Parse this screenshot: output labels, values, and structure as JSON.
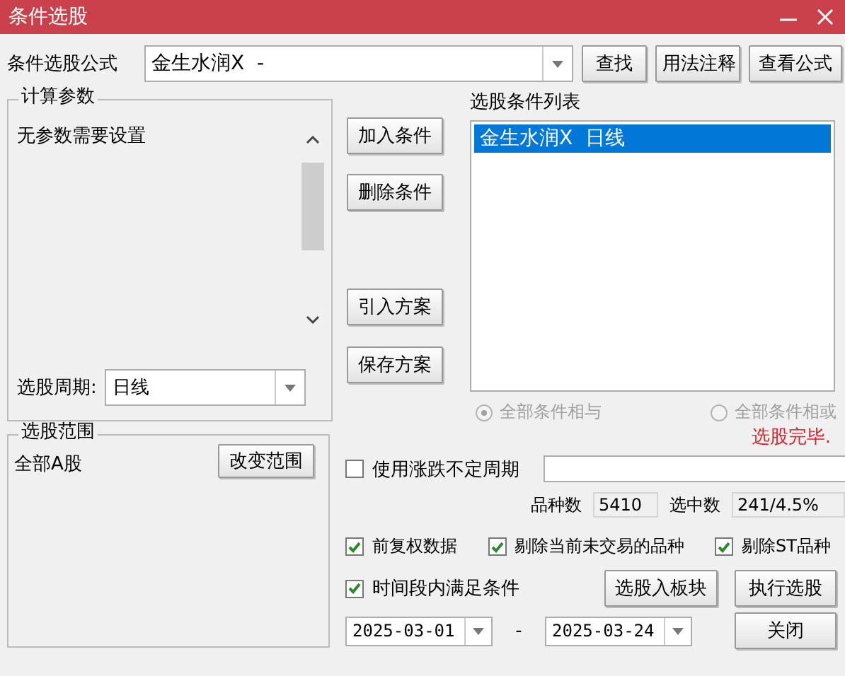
{
  "window": {
    "title": "条件选股"
  },
  "formula": {
    "label": "条件选股公式",
    "value": "金生水润X  -"
  },
  "formula_buttons": [
    "查找",
    "用法注释",
    "查看公式"
  ],
  "params": {
    "title": "计算参数",
    "message": "无参数需要设置",
    "period_label": "选股周期:",
    "period_value": "日线"
  },
  "condition_buttons": [
    "加入条件",
    "删除条件",
    "引入方案",
    "保存方案"
  ],
  "conditions": {
    "title": "选股条件列表",
    "items": [
      {
        "label": "金生水润X  日线",
        "selected": true
      }
    ]
  },
  "combine": [
    {
      "label": "全部条件相与",
      "selected": true,
      "disabled": true
    },
    {
      "label": "全部条件相或",
      "selected": false,
      "disabled": true
    }
  ],
  "status": "选股完毕.",
  "scope": {
    "title": "选股范围",
    "value": "全部A股",
    "button": "改变范围"
  },
  "variable_period": {
    "label": "使用涨跌不定周期",
    "checked": false
  },
  "stats": [
    {
      "label": "品种数",
      "value": "5410"
    },
    {
      "label": "选中数",
      "value": "241/4.5%"
    }
  ],
  "options": [
    {
      "label": "前复权数据",
      "checked": true
    },
    {
      "label": "剔除当前未交易的品种",
      "checked": true
    },
    {
      "label": "剔除ST品种",
      "checked": true
    }
  ],
  "range": {
    "label": "时间段内满足条件",
    "checked": true,
    "start": "2025-03-01",
    "separator": "-",
    "end": "2025-03-24"
  },
  "actions": [
    "选股入板块",
    "执行选股",
    "关闭"
  ]
}
